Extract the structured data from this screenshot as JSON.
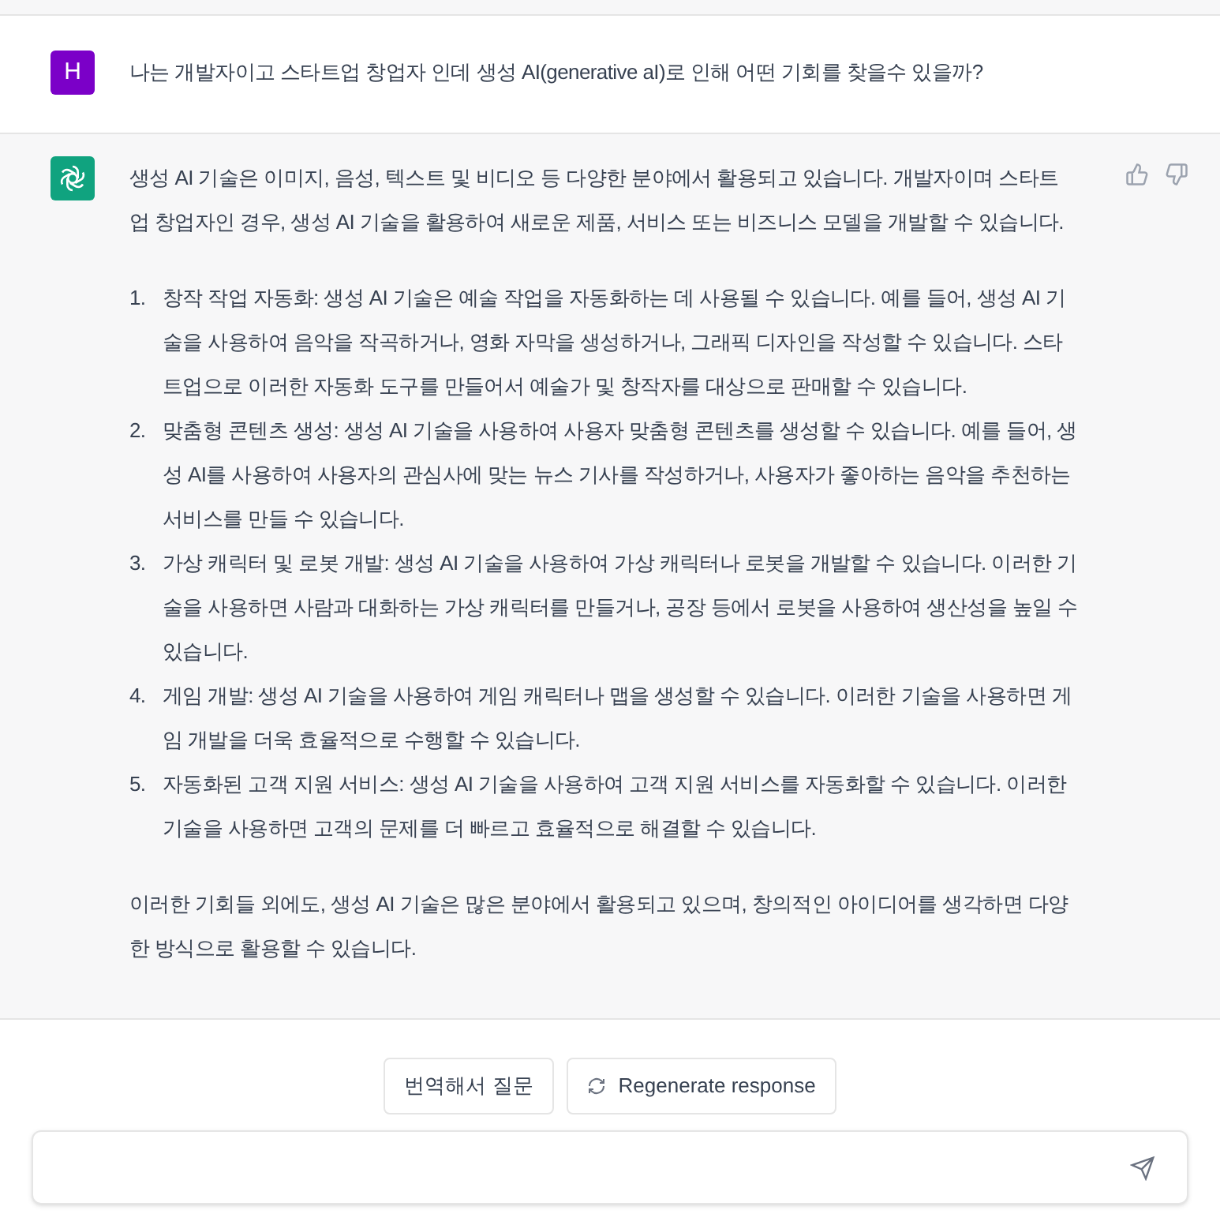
{
  "user_message": {
    "avatar": "H",
    "text": "나는 개발자이고 스타트업 창업자 인데 생성 AI(generative aI)로 인해 어떤 기회를 찾을수 있을까?"
  },
  "assistant_message": {
    "intro": "생성 AI 기술은 이미지, 음성, 텍스트 및 비디오 등 다양한 분야에서 활용되고 있습니다. 개발자이며 스타트업 창업자인 경우, 생성 AI 기술을 활용하여 새로운 제품, 서비스 또는 비즈니스 모델을 개발할 수 있습니다.",
    "list": [
      {
        "number": "1.",
        "text": "창작 작업 자동화: 생성 AI 기술은 예술 작업을 자동화하는 데 사용될 수 있습니다. 예를 들어, 생성 AI 기술을 사용하여 음악을 작곡하거나, 영화 자막을 생성하거나, 그래픽 디자인을 작성할 수 있습니다. 스타트업으로 이러한 자동화 도구를 만들어서 예술가 및 창작자를 대상으로 판매할 수 있습니다."
      },
      {
        "number": "2.",
        "text": "맞춤형 콘텐츠 생성: 생성 AI 기술을 사용하여 사용자 맞춤형 콘텐츠를 생성할 수 있습니다. 예를 들어, 생성 AI를 사용하여 사용자의 관심사에 맞는 뉴스 기사를 작성하거나, 사용자가 좋아하는 음악을 추천하는 서비스를 만들 수 있습니다."
      },
      {
        "number": "3.",
        "text": "가상 캐릭터 및 로봇 개발: 생성 AI 기술을 사용하여 가상 캐릭터나 로봇을 개발할 수 있습니다. 이러한 기술을 사용하면 사람과 대화하는 가상 캐릭터를 만들거나, 공장 등에서 로봇을 사용하여 생산성을 높일 수 있습니다."
      },
      {
        "number": "4.",
        "text": "게임 개발: 생성 AI 기술을 사용하여 게임 캐릭터나 맵을 생성할 수 있습니다. 이러한 기술을 사용하면 게임 개발을 더욱 효율적으로 수행할 수 있습니다."
      },
      {
        "number": "5.",
        "text": "자동화된 고객 지원 서비스: 생성 AI 기술을 사용하여 고객 지원 서비스를 자동화할 수 있습니다. 이러한 기술을 사용하면 고객의 문제를 더 빠르고 효율적으로 해결할 수 있습니다."
      }
    ],
    "outro": "이러한 기회들 외에도, 생성 AI 기술은 많은 분야에서 활용되고 있으며, 창의적인 아이디어를 생각하면 다양한 방식으로 활용할 수 있습니다."
  },
  "actions": [
    {
      "kind": "plain",
      "label": "번역해서 질문"
    },
    {
      "kind": "regenerate",
      "label": "Regenerate response"
    }
  ]
}
